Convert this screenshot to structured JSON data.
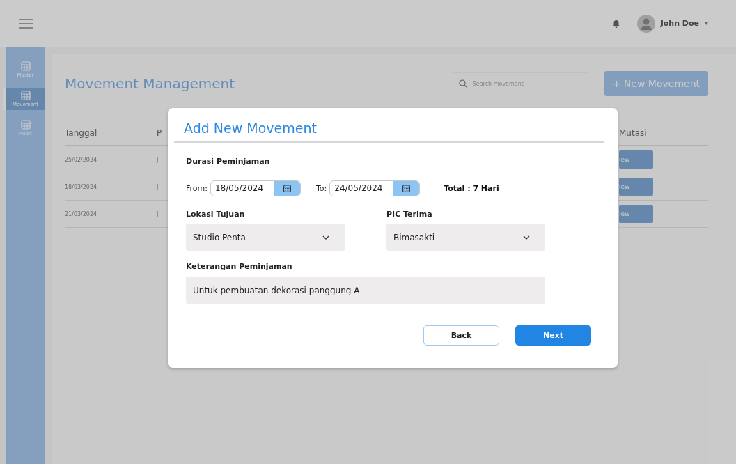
{
  "header": {
    "user_name": "John Doe"
  },
  "sidebar": {
    "items": [
      {
        "label": "Master",
        "selected": false
      },
      {
        "label": "Movement",
        "selected": true
      },
      {
        "label": "Audit",
        "selected": false
      }
    ]
  },
  "page": {
    "title": "Movement Management",
    "search": {
      "placeholder": "Search movement"
    },
    "new_button": "+ New Movement"
  },
  "table": {
    "columns": [
      "Tanggal",
      "P",
      "Mutasi"
    ],
    "rows": [
      {
        "date": "25/02/2024",
        "column_2": "J",
        "action": "iew"
      },
      {
        "date": "18/03/2024",
        "column_2": "J",
        "action": "iew"
      },
      {
        "date": "21/03/2024",
        "column_2": "J",
        "action": "iew"
      }
    ]
  },
  "modal": {
    "title": "Add New Movement",
    "duration": {
      "label": "Durasi Peminjaman",
      "from_label": "From:",
      "from": "18/05/2024",
      "to_label": "To:",
      "to": "24/05/2024",
      "total": "Total : 7 Hari"
    },
    "selects": [
      {
        "label": "Lokasi Tujuan",
        "value": "Studio Penta"
      },
      {
        "label": "PIC Terima",
        "value": "Bimasakti"
      }
    ],
    "note": {
      "label": "Keterangan Peminjaman",
      "value": "Untuk pembuatan dekorasi panggung A"
    },
    "buttons": [
      {
        "label": "Back",
        "kind": "secondary"
      },
      {
        "label": "Next",
        "kind": "primary"
      }
    ]
  }
}
